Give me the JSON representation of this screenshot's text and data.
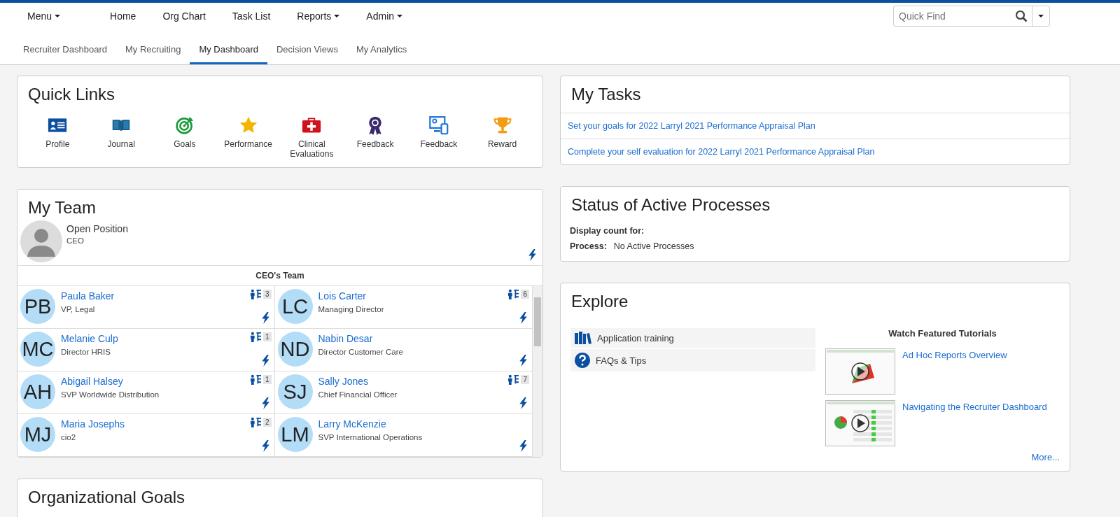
{
  "nav": {
    "items": [
      {
        "label": "Menu",
        "dropdown": true
      },
      {
        "label": "Home",
        "dropdown": false
      },
      {
        "label": "Org Chart",
        "dropdown": false
      },
      {
        "label": "Task List",
        "dropdown": false
      },
      {
        "label": "Reports",
        "dropdown": true
      },
      {
        "label": "Admin",
        "dropdown": true
      }
    ],
    "search": {
      "placeholder": "Quick Find"
    }
  },
  "tabs": [
    {
      "label": "Recruiter Dashboard",
      "selected": false
    },
    {
      "label": "My Recruiting",
      "selected": false
    },
    {
      "label": "My Dashboard",
      "selected": true
    },
    {
      "label": "Decision Views",
      "selected": false
    },
    {
      "label": "My Analytics",
      "selected": false
    }
  ],
  "quick_links": {
    "title": "Quick Links",
    "items": [
      {
        "label": "Profile",
        "kind": "card"
      },
      {
        "label": "Journal",
        "kind": "book"
      },
      {
        "label": "Goals",
        "kind": "target"
      },
      {
        "label": "Performance",
        "kind": "star"
      },
      {
        "label": "Clinical Evaluations",
        "kind": "medkit"
      },
      {
        "label": "Feedback",
        "kind": "ribbon"
      },
      {
        "label": "Feedback",
        "kind": "devices"
      },
      {
        "label": "Reward",
        "kind": "trophy"
      }
    ]
  },
  "my_team": {
    "title": "My Team",
    "lead": {
      "name": "Open Position",
      "title": "CEO"
    },
    "team_title": "CEO's Team",
    "members": [
      {
        "initials": "PB",
        "name": "Paula Baker",
        "title": "VP, Legal",
        "reports": "3"
      },
      {
        "initials": "LC",
        "name": "Lois Carter",
        "title": "Managing Director",
        "reports": "6"
      },
      {
        "initials": "MC",
        "name": "Melanie Culp",
        "title": "Director HRIS",
        "reports": "1"
      },
      {
        "initials": "ND",
        "name": "Nabin Desar",
        "title": "Director Customer Care"
      },
      {
        "initials": "AH",
        "name": "Abigail Halsey",
        "title": "SVP Worldwide Distribution",
        "reports": "1"
      },
      {
        "initials": "SJ",
        "name": "Sally Jones",
        "title": "Chief Financial Officer",
        "reports": "7"
      },
      {
        "initials": "MJ",
        "name": "Maria Josephs",
        "title": "cio2",
        "reports": "2"
      },
      {
        "initials": "LM",
        "name": "Larry McKenzie",
        "title": "SVP International Operations"
      }
    ]
  },
  "org_goals": {
    "title": "Organizational Goals"
  },
  "my_tasks": {
    "title": "My Tasks",
    "items": [
      "Set your goals for 2022 Larryl 2021 Performance Appraisal Plan",
      "Complete your self evaluation for 2022 Larryl 2021 Performance Appraisal Plan"
    ]
  },
  "status": {
    "title": "Status of Active Processes",
    "display_label": "Display count for:",
    "process_label": "Process:",
    "process_value": "No Active Processes"
  },
  "explore": {
    "title": "Explore",
    "links": [
      {
        "label": "Application training",
        "kind": "books"
      },
      {
        "label": "FAQs & Tips",
        "kind": "help"
      }
    ],
    "tutorials_title": "Watch Featured Tutorials",
    "tutorials": [
      {
        "title": "Ad Hoc Reports Overview",
        "kind": "chart"
      },
      {
        "title": "Navigating the Recruiter Dashboard",
        "kind": "dashboard"
      }
    ],
    "more": "More..."
  }
}
